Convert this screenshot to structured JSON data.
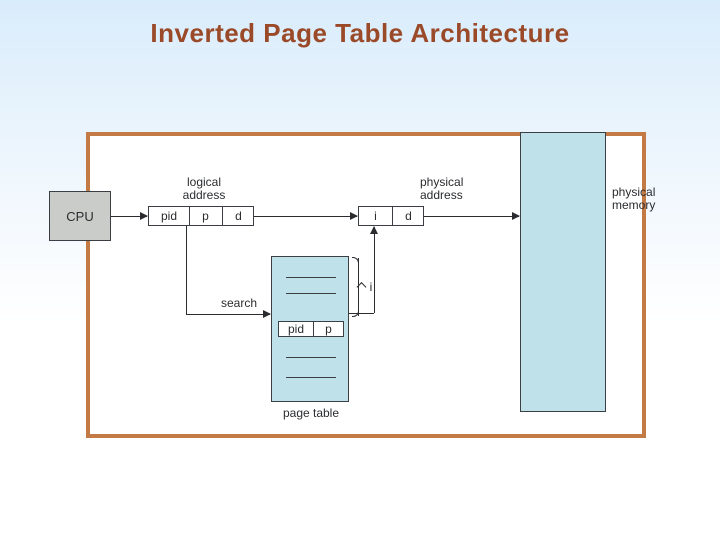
{
  "title": "Inverted Page Table Architecture",
  "cpu": {
    "label": "CPU"
  },
  "logical_address": {
    "caption": "logical\naddress",
    "cells": [
      "pid",
      "p",
      "d"
    ]
  },
  "physical_address": {
    "caption": "physical\naddress",
    "cells": [
      "i",
      "d"
    ]
  },
  "search_label": "search",
  "page_table": {
    "caption": "page table",
    "highlight_cells": [
      "pid",
      "p"
    ],
    "index_label": "i"
  },
  "physical_memory": {
    "caption": "physical\nmemory"
  }
}
